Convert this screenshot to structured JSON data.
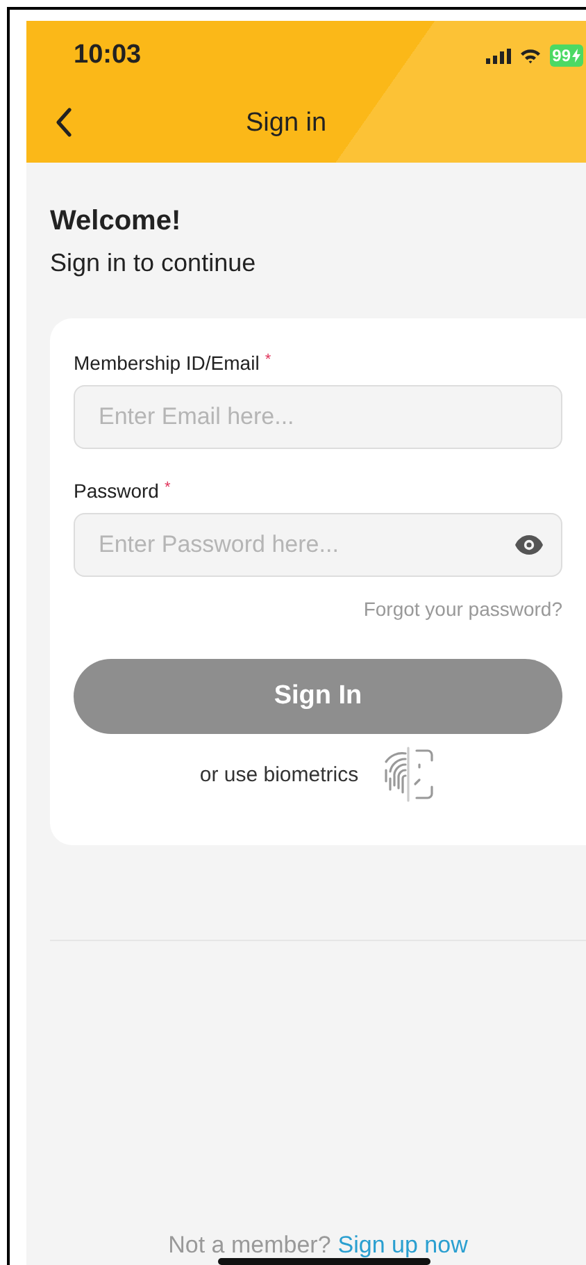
{
  "status_bar": {
    "time": "10:03",
    "battery": "99"
  },
  "header": {
    "title": "Sign in"
  },
  "welcome": {
    "title": "Welcome!",
    "subtitle": "Sign in to continue"
  },
  "form": {
    "fields": [
      {
        "label": "Membership ID/Email",
        "required_mark": "*",
        "placeholder": "Enter Email here...",
        "kind": "text"
      },
      {
        "label": "Password",
        "required_mark": "*",
        "placeholder": "Enter Password here...",
        "kind": "password"
      }
    ],
    "forgot_link": "Forgot your password?",
    "submit": {
      "label": "Sign In",
      "disabled": true
    },
    "biometrics": "or use biometrics"
  },
  "footer": {
    "prompt": "Not a member?",
    "link": "Sign up now"
  }
}
